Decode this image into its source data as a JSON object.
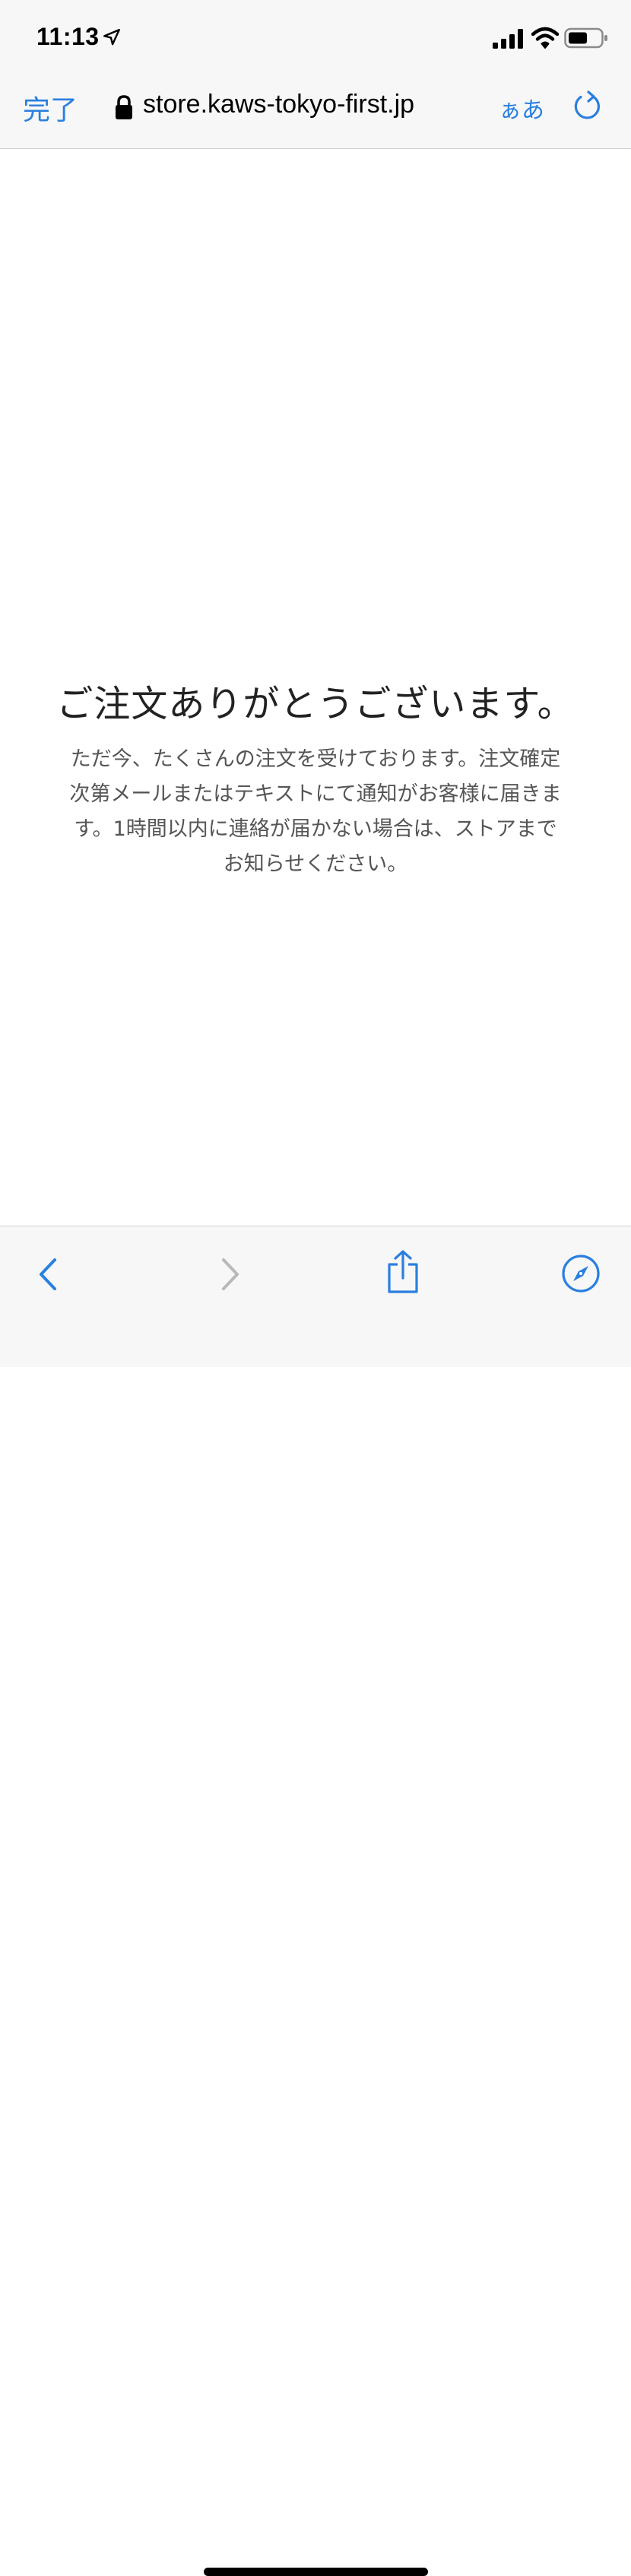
{
  "status_bar": {
    "time": "11:13",
    "icons": [
      "location-arrow-icon",
      "cellular-signal-icon",
      "wifi-icon",
      "battery-icon"
    ]
  },
  "nav_bar": {
    "done_label": "完了",
    "url": "store.kaws-tokyo-first.jp",
    "text_size_label": "ぁあ",
    "icons": [
      "lock-icon",
      "reload-icon"
    ]
  },
  "page": {
    "title": "ご注文ありがとうございます。",
    "message_lines": [
      "ただ今、たくさんの注文を受けております。注文確定",
      "次第メールまたはテキストにて通知がお客様に届きま",
      "す。1時間以内に連絡が届かない場合は、ストアまで",
      "お知らせください。"
    ]
  },
  "toolbar": {
    "icons": [
      "back-icon",
      "forward-icon",
      "share-icon",
      "compass-icon"
    ],
    "back_enabled": true,
    "forward_enabled": false
  },
  "colors": {
    "accent": "#2a7fe0",
    "bar_background": "#f7f7f7",
    "title_text": "#222222",
    "body_text": "#555555",
    "disabled": "#b8b8b8"
  }
}
